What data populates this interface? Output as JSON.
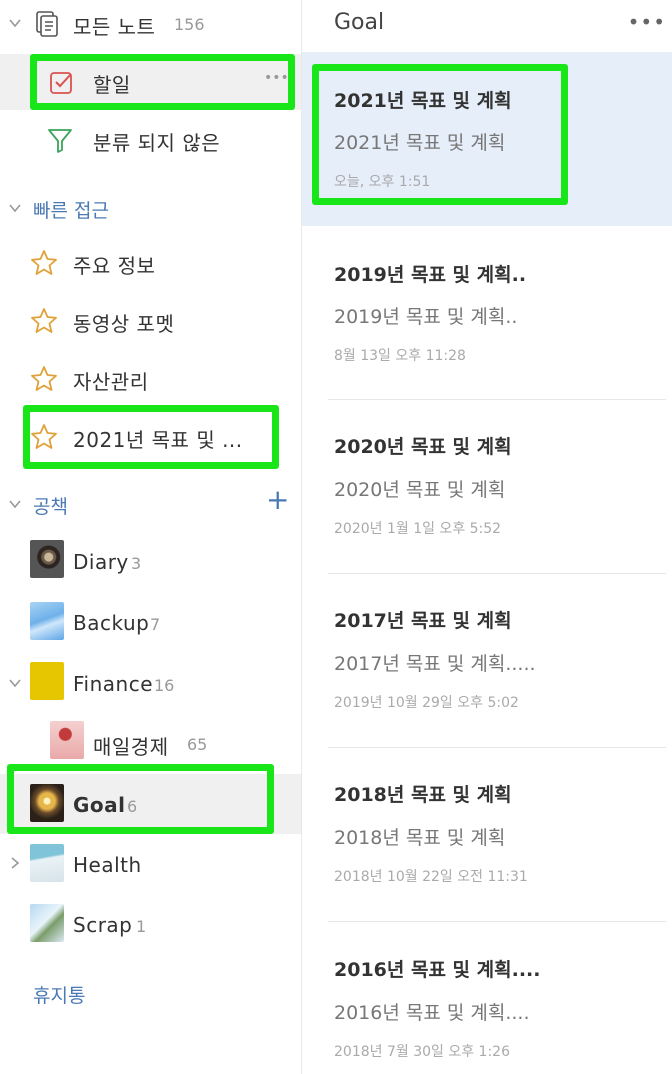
{
  "sidebar": {
    "all_notes": {
      "label": "모든 노트",
      "count": "156"
    },
    "todo": {
      "label": "할일",
      "more": "•••"
    },
    "uncategorized": {
      "label": "분류 되지 않은"
    },
    "quick_access": {
      "title": "빠른 접근",
      "items": [
        {
          "label": "주요 정보"
        },
        {
          "label": "동영상 포멧"
        },
        {
          "label": "자산관리"
        },
        {
          "label": "2021년 목표 및 ..."
        }
      ]
    },
    "notebooks": {
      "title": "공책",
      "add": "+",
      "items": [
        {
          "label": "Diary",
          "count": "3"
        },
        {
          "label": "Backup",
          "count": "7"
        },
        {
          "label": "Finance",
          "count": "16"
        },
        {
          "label": "매일경제",
          "count": "65"
        },
        {
          "label": "Goal",
          "count": "6"
        },
        {
          "label": "Health",
          "count": ""
        },
        {
          "label": "Scrap",
          "count": "1"
        }
      ]
    },
    "trash": {
      "label": "휴지통"
    }
  },
  "list": {
    "title": "Goal",
    "more": "•••",
    "notes": [
      {
        "title": "2021년 목표 및 계획",
        "preview": "2021년 목표 및 계획",
        "date": "오늘, 오후 1:51"
      },
      {
        "title": "2019년 목표 및 계획..",
        "preview": "2019년 목표 및 계획..",
        "date": "8월 13일 오후 11:28"
      },
      {
        "title": "2020년 목표 및 계획",
        "preview": "2020년 목표 및 계획",
        "date": "2020년 1월 1일 오후 5:52"
      },
      {
        "title": "2017년 목표 및 계획",
        "preview": "2017년 목표 및 계획.....",
        "date": "2019년 10월 29일 오후 5:02"
      },
      {
        "title": "2018년 목표 및 계획",
        "preview": "2018년 목표 및 계획",
        "date": "2018년 10월 22일 오전 11:31"
      },
      {
        "title": "2016년 목표 및 계획....",
        "preview": "2016년 목표 및 계획....",
        "date": "2018년 7월 30일 오후 1:26"
      }
    ]
  },
  "colors": {
    "accent_blue": "#4a7ab5",
    "highlight_green": "#19e619",
    "selected_note_bg": "#e6eefa",
    "selected_row_bg": "#f0f0f0"
  }
}
